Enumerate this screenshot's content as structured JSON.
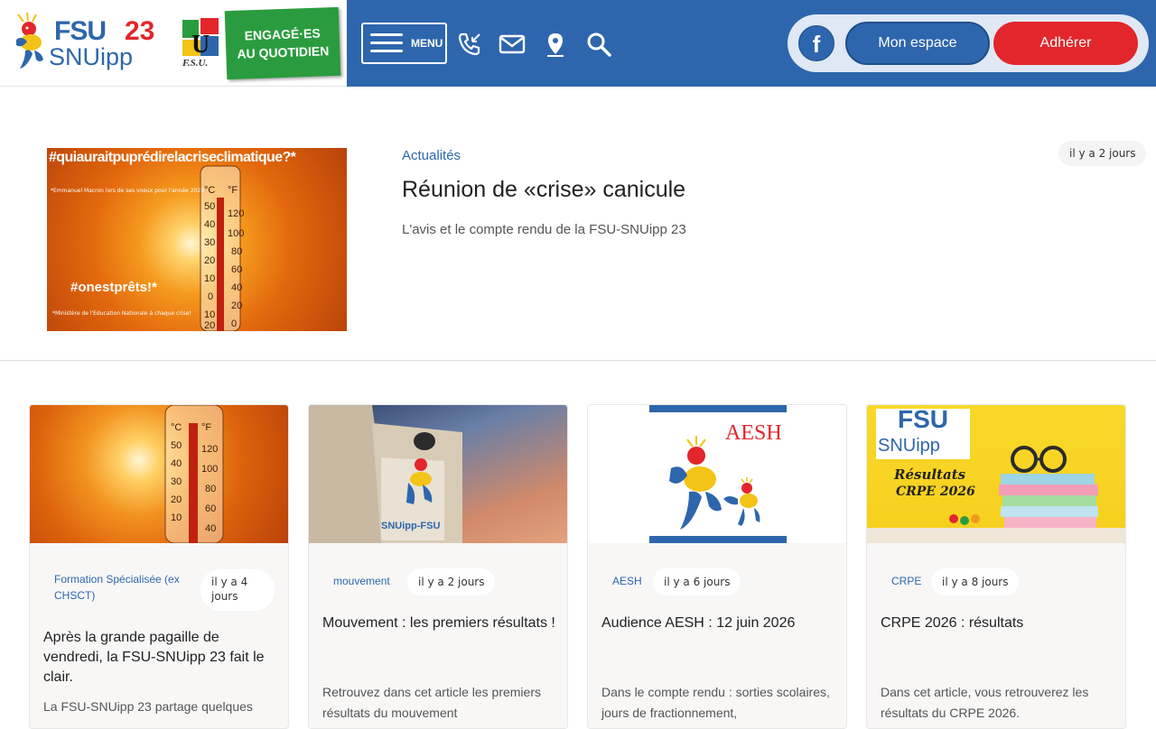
{
  "brand": {
    "fsu": "FSU",
    "number": "23",
    "snuipp": "SNUipp",
    "union_small": "F.S.U.",
    "engage_line1": "ENGAGÉ·ES",
    "engage_line2": "AU QUOTIDIEN"
  },
  "colors": {
    "primary": "#2e66ad",
    "accent": "#e2262b",
    "green": "#2a9c3f"
  },
  "nav": {
    "menu_label": "MENU",
    "icons": [
      "phone-icon",
      "mail-icon",
      "location-icon",
      "search-icon"
    ],
    "facebook_icon": "f",
    "espace_label": "Mon espace",
    "adherer_label": "Adhérer"
  },
  "featured": {
    "tag": "Actualités",
    "date": "il y a 2 jours",
    "title": "Réunion de «crise» canicule",
    "subtitle": "L'avis et le compte rendu de la FSU-SNUipp 23",
    "image_texts": {
      "hashtag_top": "#quiauraitpuprédirelacriseclimatique?*",
      "quote_small": "*Emmanuel Macron lors de ses voeux pour l'année 2023",
      "hashtag_bottom": "#onestprêts!*",
      "footnote": "*Ministère de l'Education Nationale à chaque crise!"
    }
  },
  "cards": [
    {
      "tag": "Formation Spécialisée (ex CHSCT)",
      "date": "il y a 4 jours",
      "title": "Après la grande pagaille de vendredi, la FSU-SNUipp 23 fait le clair.",
      "desc": "La FSU-SNUipp 23 partage quelques"
    },
    {
      "tag": "mouvement",
      "date": "il y a 2 jours",
      "title": "Mouvement : les premiers résultats !",
      "desc": "Retrouvez dans cet article les premiers résultats du mouvement",
      "image_text": "SNUipp-FSU"
    },
    {
      "tag": "AESH",
      "date": "il y a 6 jours",
      "title": "Audience AESH : 12 juin 2026",
      "desc": "Dans le compte rendu : sorties scolaires, jours de fractionnement,",
      "image_text": "AESH"
    },
    {
      "tag": "CRPE",
      "date": "il y a 8 jours",
      "title": "CRPE 2026 : résultats",
      "desc": "Dans cet article, vous retrouverez les résultats du CRPE 2026.",
      "image_text_fsu": "FSU",
      "image_text_snuipp": "SNUipp",
      "image_text_line1": "Résultats",
      "image_text_line2": "CRPE 2026"
    }
  ]
}
